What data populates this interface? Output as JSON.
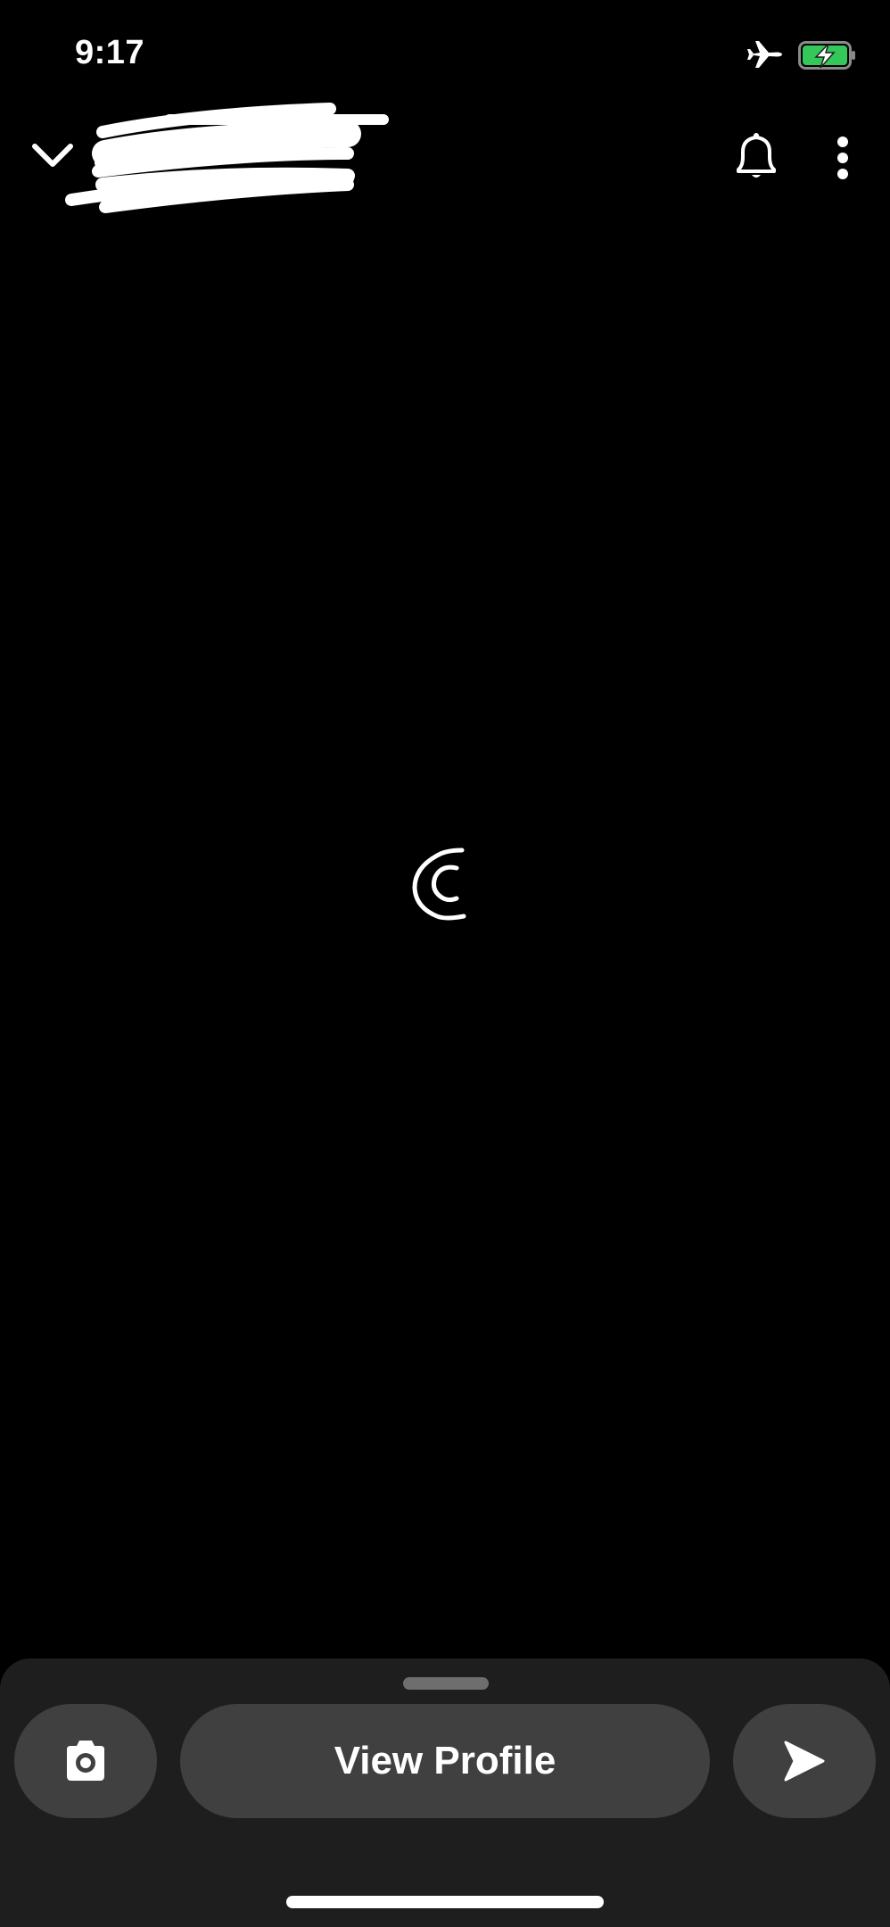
{
  "status_bar": {
    "time": "9:17",
    "icons": [
      "airplane-mode-icon",
      "battery-charging-icon"
    ],
    "battery_color": "#34c759"
  },
  "header": {
    "back_icon": "chevron-down-icon",
    "title_redacted": true,
    "notification_icon": "bell-icon",
    "more_icon": "more-vertical-icon"
  },
  "content": {
    "loading_icon": "loading-spinner-icon"
  },
  "bottom_bar": {
    "camera_icon": "camera-icon",
    "view_profile_label": "View Profile",
    "send_icon": "send-icon"
  }
}
